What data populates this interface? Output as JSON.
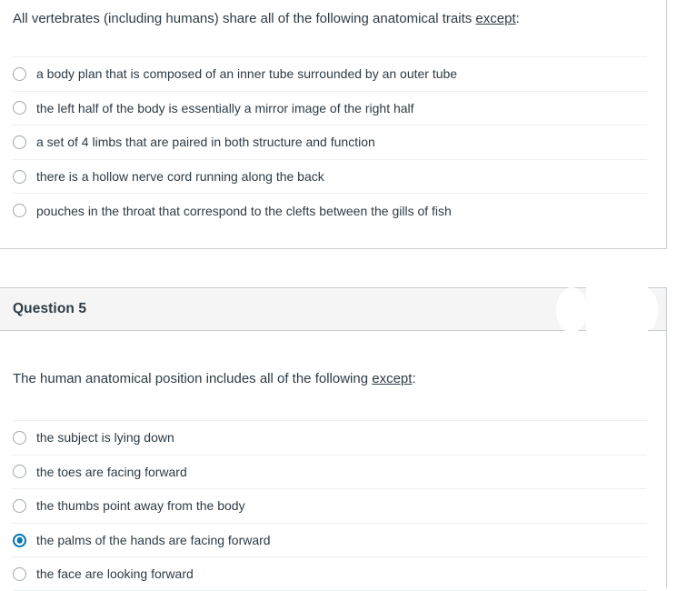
{
  "colors": {
    "selected_radio": "#0374B5",
    "unselected_radio_border": "#9EA6AD",
    "card_border": "#C7CDD1",
    "separator": "#ECEFF1",
    "header_background": "#F5F5F5",
    "text": "#2D3B45"
  },
  "questions": [
    {
      "prompt_before": "All vertebrates (including humans) share all of the following anatomical traits ",
      "prompt_underlined": "except",
      "prompt_after": ":",
      "options": [
        {
          "label": "a body plan that is composed of an inner tube surrounded by an outer tube",
          "selected": false
        },
        {
          "label": "the left half of the body is essentially a mirror image of the right half",
          "selected": false
        },
        {
          "label": "a set of 4 limbs that are paired in both structure and function",
          "selected": false
        },
        {
          "label": "there is a hollow nerve cord running along the back",
          "selected": false
        },
        {
          "label": "pouches in the throat that correspond to the clefts between the gills of fish",
          "selected": false
        }
      ]
    },
    {
      "header_title": "Question 5",
      "prompt_before": "The human anatomical position includes all of the following ",
      "prompt_underlined": "except",
      "prompt_after": ":",
      "options": [
        {
          "label": "the subject is lying down",
          "selected": false
        },
        {
          "label": "the toes are facing forward",
          "selected": false
        },
        {
          "label": "the thumbs point away from the body",
          "selected": false
        },
        {
          "label": "the palms of the hands are facing forward",
          "selected": true
        },
        {
          "label": "the face are looking forward",
          "selected": false
        }
      ]
    }
  ]
}
